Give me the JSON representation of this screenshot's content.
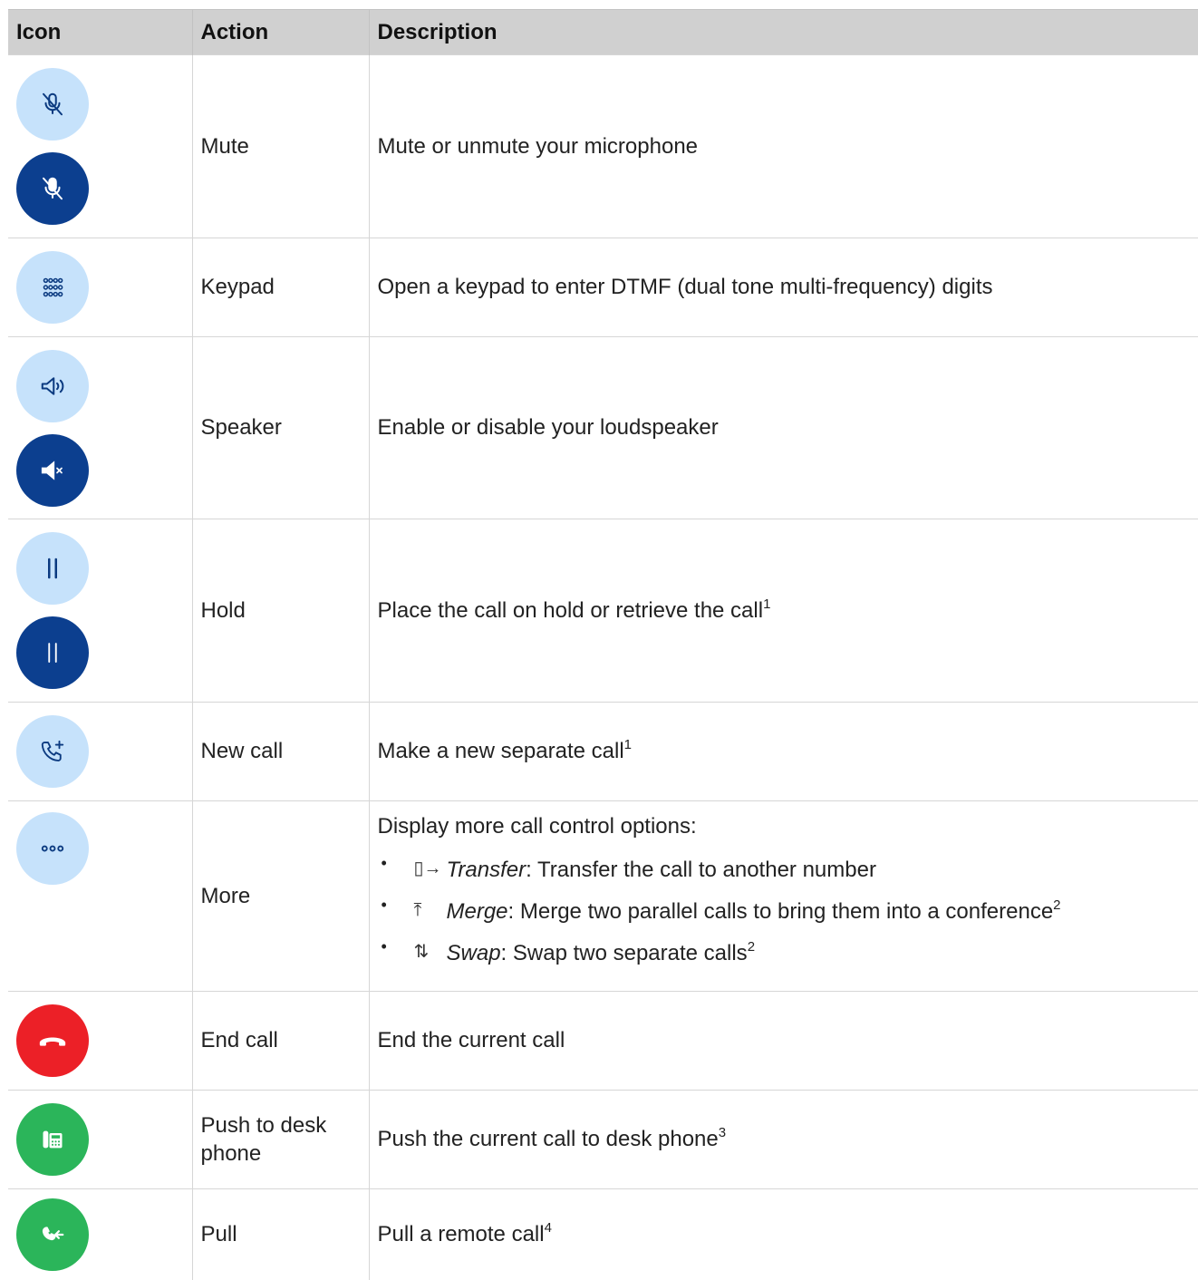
{
  "header": {
    "icon": "Icon",
    "action": "Action",
    "description": "Description"
  },
  "colors": {
    "light_blue": "#c6e2fb",
    "dark_blue": "#0c3f8f",
    "red": "#ec2027",
    "green": "#2bb55a"
  },
  "rows": [
    {
      "action": "Mute",
      "description": "Mute or unmute your microphone",
      "icons": [
        "mic-off-icon",
        "mic-off-icon"
      ]
    },
    {
      "action": "Keypad",
      "description": "Open a keypad to enter DTMF (dual tone multi-frequency) digits",
      "icons": [
        "keypad-icon"
      ]
    },
    {
      "action": "Speaker",
      "description": "Enable or disable your loudspeaker",
      "icons": [
        "speaker-icon",
        "speaker-muted-icon"
      ]
    },
    {
      "action": "Hold",
      "description": "Place the call on hold or retrieve the call",
      "sup": "1",
      "icons": [
        "pause-icon",
        "pause-icon"
      ]
    },
    {
      "action": "New call",
      "description": "Make a new separate call",
      "sup": "1",
      "icons": [
        "phone-add-icon"
      ]
    },
    {
      "action": "More",
      "description": "Display more call control options:",
      "icons": [
        "more-icon"
      ],
      "options": [
        {
          "name": "Transfer",
          "text": ": Transfer the call to another number",
          "sup": "",
          "icon": "transfer-icon"
        },
        {
          "name": "Merge",
          "text": ": Merge two parallel calls to bring them into a conference",
          "sup": "2",
          "icon": "merge-icon"
        },
        {
          "name": "Swap",
          "text": ": Swap two separate calls",
          "sup": "2",
          "icon": "swap-icon"
        }
      ]
    },
    {
      "action": "End call",
      "description": "End the current call",
      "icons": [
        "hang-up-icon"
      ]
    },
    {
      "action": "Push to desk phone",
      "description": "Push the current call to desk phone",
      "sup": "3",
      "icons": [
        "desk-phone-icon"
      ]
    },
    {
      "action": "Pull",
      "description": "Pull a remote call",
      "sup": "4",
      "icons": [
        "pull-call-icon"
      ]
    }
  ]
}
